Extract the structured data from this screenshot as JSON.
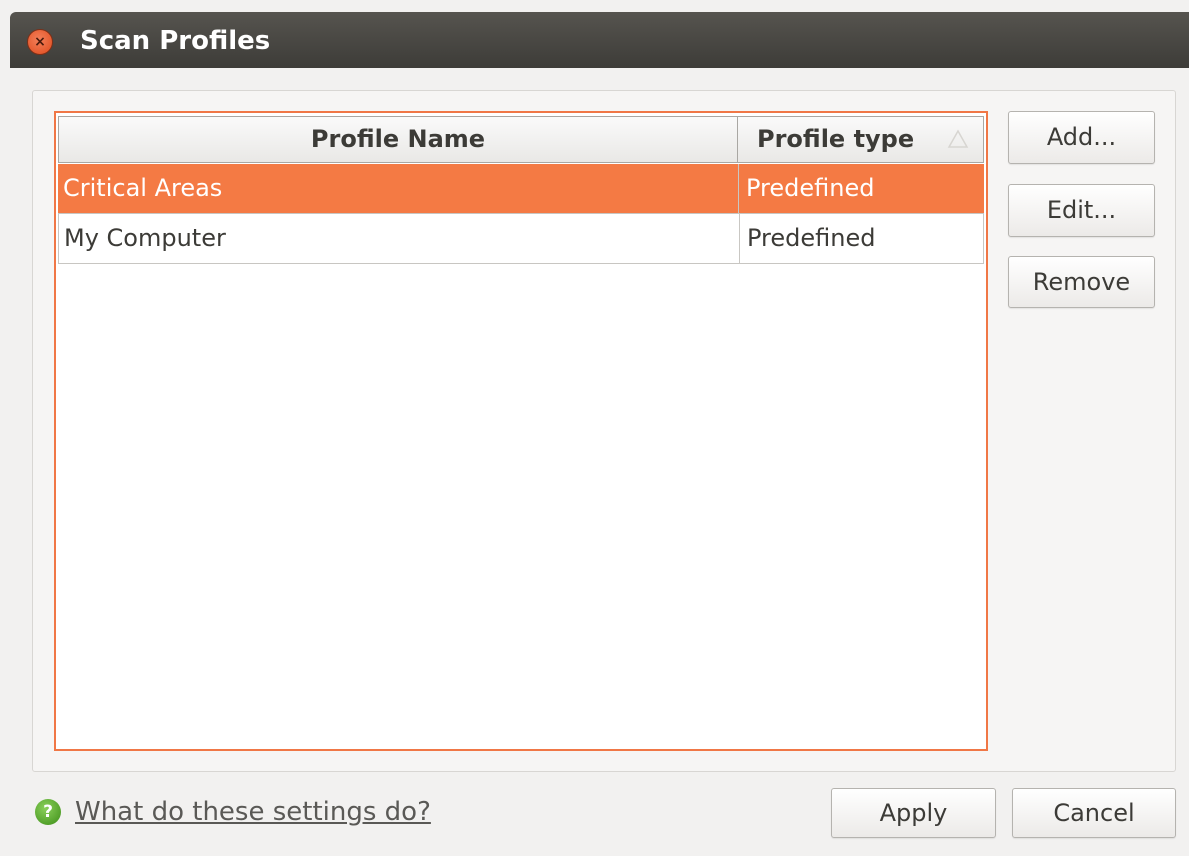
{
  "window": {
    "title": "Scan Profiles",
    "close_icon": "close-icon"
  },
  "table": {
    "columns": [
      "Profile Name",
      "Profile type"
    ],
    "sort_icon": "sort-ascending-icon",
    "rows": [
      {
        "name": "Critical Areas",
        "type": "Predefined",
        "selected": true
      },
      {
        "name": "My Computer",
        "type": "Predefined",
        "selected": false
      }
    ]
  },
  "side_buttons": {
    "add": "Add...",
    "edit": "Edit...",
    "remove": "Remove"
  },
  "footer": {
    "help_icon": "help-icon",
    "help_link": "What do these settings do?",
    "apply": "Apply",
    "cancel": "Cancel"
  },
  "colors": {
    "accent": "#f47a44",
    "frame": "#f07746",
    "titlebar": "#3d3c38"
  }
}
